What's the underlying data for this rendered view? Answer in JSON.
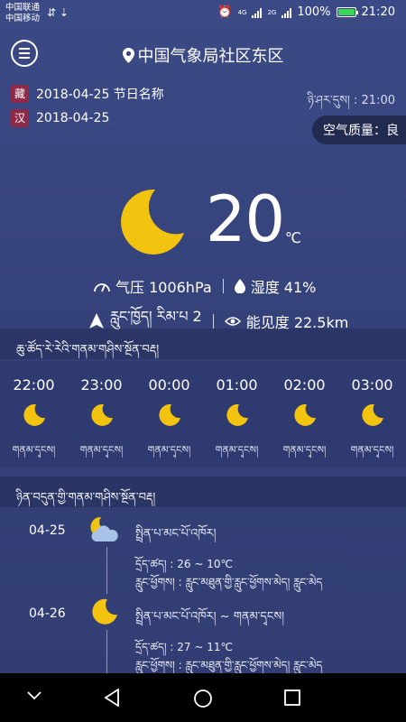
{
  "status_bar": {
    "carrier_1": "中国联通",
    "carrier_2": "中国移动",
    "network_1": "4G",
    "network_2": "2G",
    "battery": "100%",
    "battery_level": 1.0,
    "time": "21:20"
  },
  "header": {
    "location": "中国气象局社区东区"
  },
  "dates": {
    "tibetan_tag": "藏",
    "tibetan_date": "2018-04-25 节日名称",
    "chinese_tag": "汉",
    "chinese_date": "2018-04-25",
    "sunrise": "ཉི་ཤར་དུས། : 21:00"
  },
  "aqi": {
    "label": "空气质量：良"
  },
  "current": {
    "temperature": "20",
    "unit": "℃",
    "pressure": "气压 1006hPa",
    "humidity": "湿度 41%",
    "wind": "རླུང་ཁྱོད། རིམ་པ 2",
    "visibility": "能见度 22.5km",
    "icon": "moon-icon"
  },
  "hourly": {
    "title": "ཆུ་ཚོད་རེ་རེའི་གནམ་གཤིས་སྔོན་བརྡ།",
    "items": [
      {
        "time": "22:00",
        "desc": "གནམ་དྭངས།",
        "icon": "moon-icon"
      },
      {
        "time": "23:00",
        "desc": "གནམ་དྭངས།",
        "icon": "moon-icon"
      },
      {
        "time": "00:00",
        "desc": "གནམ་དྭངས།",
        "icon": "moon-icon"
      },
      {
        "time": "01:00",
        "desc": "གནམ་དྭངས།",
        "icon": "moon-icon"
      },
      {
        "time": "02:00",
        "desc": "གནམ་དྭངས།",
        "icon": "moon-icon"
      },
      {
        "time": "03:00",
        "desc": "གནམ་དྭངས།",
        "icon": "moon-icon"
      }
    ]
  },
  "daily": {
    "title": "ཉིན་བདུན་གྱི་གནམ་གཤིས་སྔོན་བརྡ།",
    "items": [
      {
        "date": "04-25",
        "icon": "cloudy-moon-icon",
        "weather": "སྤྲིན་པ་མང་པོ་འཁོར།",
        "temp": "དྲོད་ཚད། : 26 ~ 10℃",
        "wind": "རླུང་ཕྱོགས། : རླུང་མཐུན་གྱི་རླུང་ཕྱོགས་མེད། རླུང་མེད"
      },
      {
        "date": "04-26",
        "icon": "moon-icon",
        "weather": "སྤྲིན་པ་མང་པོ་འཁོར། ~ གནམ་དྭངས།",
        "temp": "དྲོད་ཚད། : 27 ~ 11℃",
        "wind": "རླུང་ཕྱོགས། : རླུང་མཐུན་གྱི་རླུང་ཕྱོགས་མེད། རླུང་མེད"
      }
    ]
  },
  "colors": {
    "background": "#3b4a86",
    "moon": "#f2c40f",
    "tag": "#8e2a48"
  }
}
